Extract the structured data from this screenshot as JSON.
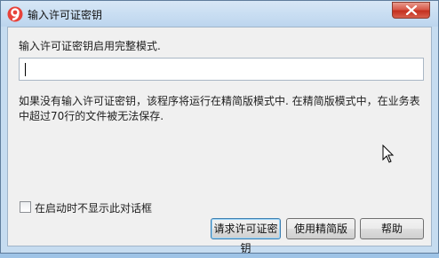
{
  "window": {
    "title": "输入许可证密钥",
    "icon": "app-logo-9-icon",
    "close_icon": "close-icon"
  },
  "form": {
    "prompt": "输入许可证密钥启用完整模式.",
    "key_value": "",
    "key_placeholder": "",
    "description": "如果没有输入许可证密钥，该程序将运行在精简版模式中. 在精简版模式中，在业务表中超过70行的文件被无法保存.",
    "checkbox_label": "在启动时不显示此对话框",
    "checkbox_checked": false
  },
  "buttons": {
    "request_license": "请求许可证密钥",
    "use_lite": "使用精简版",
    "help": "帮助"
  },
  "colors": {
    "accent_red": "#d8594a",
    "title_bar": "#c6dcf0"
  }
}
